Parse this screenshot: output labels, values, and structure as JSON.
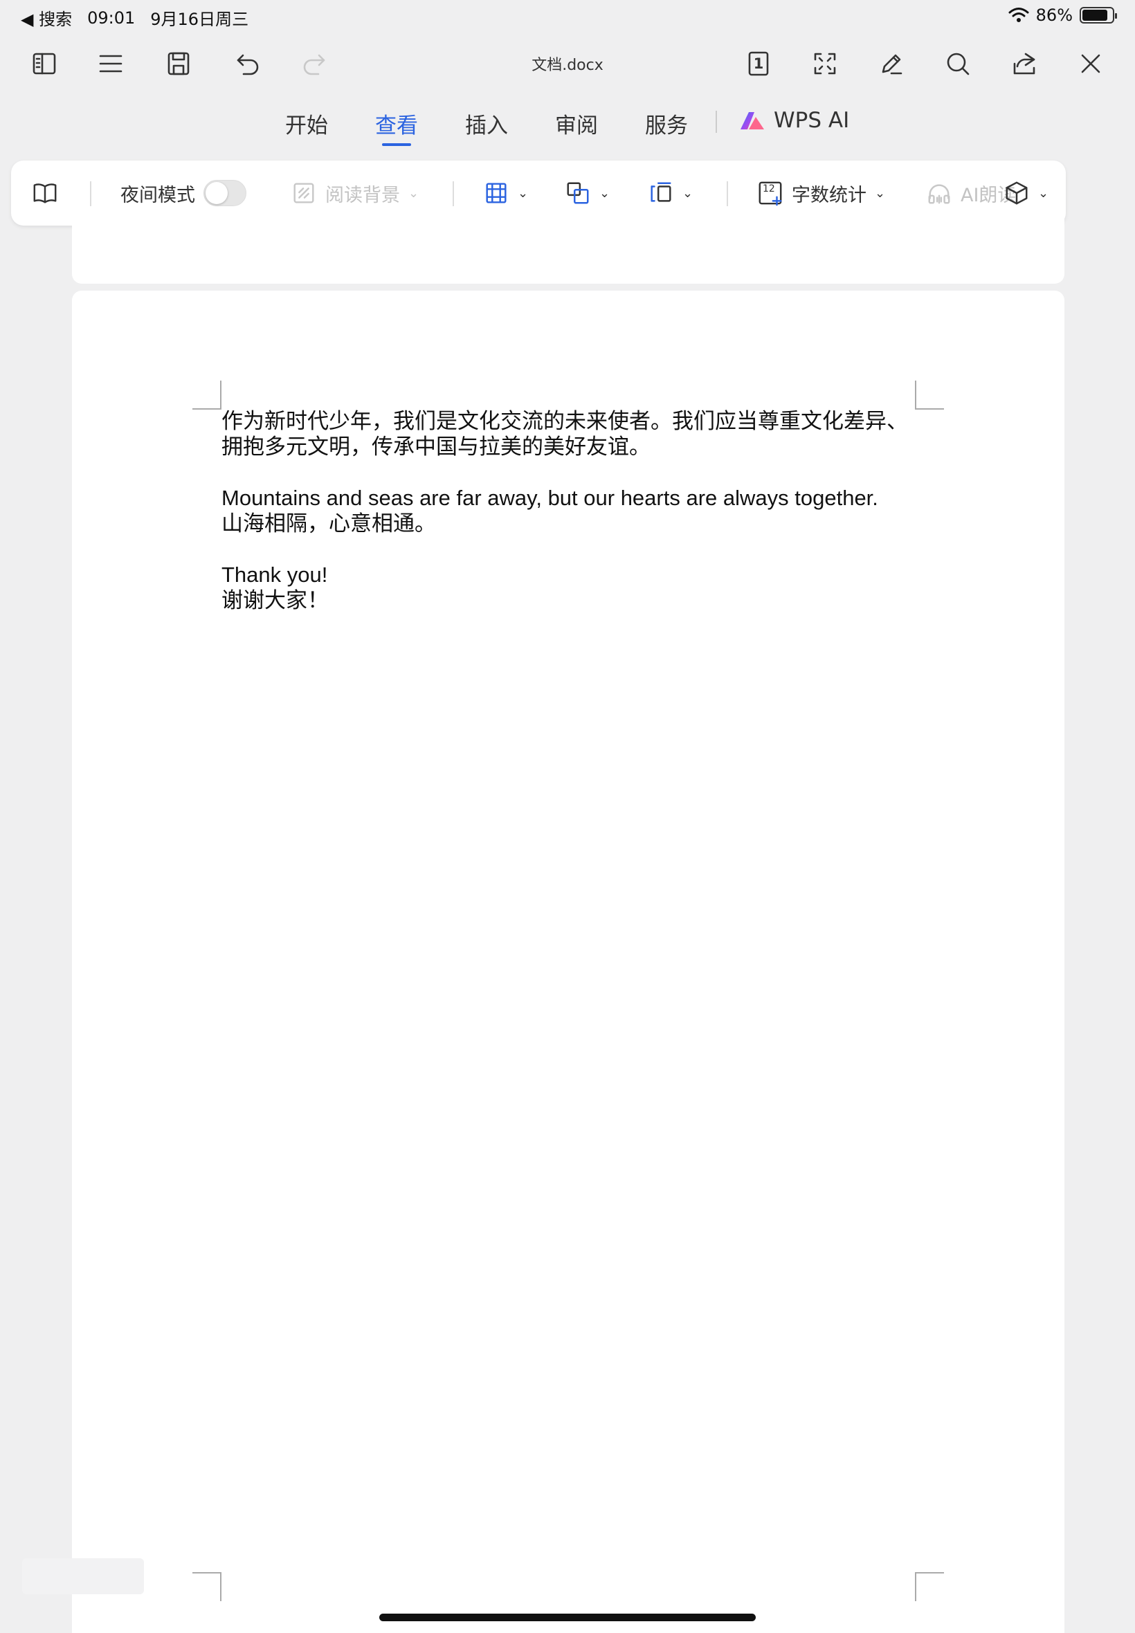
{
  "status_bar": {
    "back_label": "◀ 搜索",
    "time": "09:01",
    "date": "9月16日周三",
    "battery": "86%",
    "battery_level": 0.86
  },
  "toolbar": {
    "title": "文档.docx",
    "page_number": "1"
  },
  "menu": {
    "tabs": [
      {
        "label": "开始"
      },
      {
        "label": "查看"
      },
      {
        "label": "插入"
      },
      {
        "label": "审阅"
      },
      {
        "label": "服务"
      }
    ],
    "active_tab": "查看",
    "ai_label": "WPS AI"
  },
  "ribbon": {
    "night_mode_label": "夜间模式",
    "night_mode_on": false,
    "reading_bg_label": "阅读背景",
    "word_count_badge": "12",
    "word_count_label": "字数统计",
    "ai_read_label": "AI朗读"
  },
  "document": {
    "paragraphs": [
      "作为新时代少年，我们是文化交流的未来使者。我们应当尊重文化差异、拥抱多元文明，传承中国与拉美的美好友谊。",
      "Mountains and seas are far away, but our hearts are always together.\n山海相隔，心意相通。",
      "Thank you!\n谢谢大家！"
    ]
  },
  "colors": {
    "accent": "#2b63e0",
    "background": "#efeff0"
  }
}
